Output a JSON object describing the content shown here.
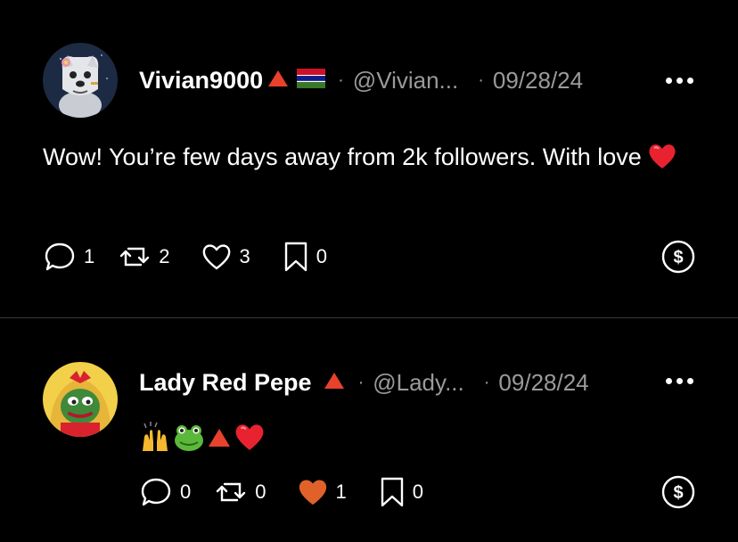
{
  "posts": [
    {
      "author": "Vivian9000",
      "handle": "@Vivian...",
      "date": "09/28/24",
      "dot": "·",
      "text": "Wow! You’re few days away from 2k followers. With love",
      "counts": {
        "replies": "1",
        "reposts": "2",
        "likes": "3",
        "bookmarks": "0"
      },
      "liked": false
    },
    {
      "author": "Lady Red Pepe",
      "handle": "@Lady...",
      "date": "09/28/24",
      "dot": "·",
      "text_emojis": [
        "raised-hands",
        "frog",
        "red-triangle",
        "red-heart"
      ],
      "counts": {
        "replies": "0",
        "reposts": "0",
        "likes": "1",
        "bookmarks": "0"
      },
      "liked": true
    }
  ],
  "colors": {
    "background": "#000000",
    "muted": "#9a9a9a",
    "like_active": "#e0622a",
    "badge": "#e8412c"
  }
}
